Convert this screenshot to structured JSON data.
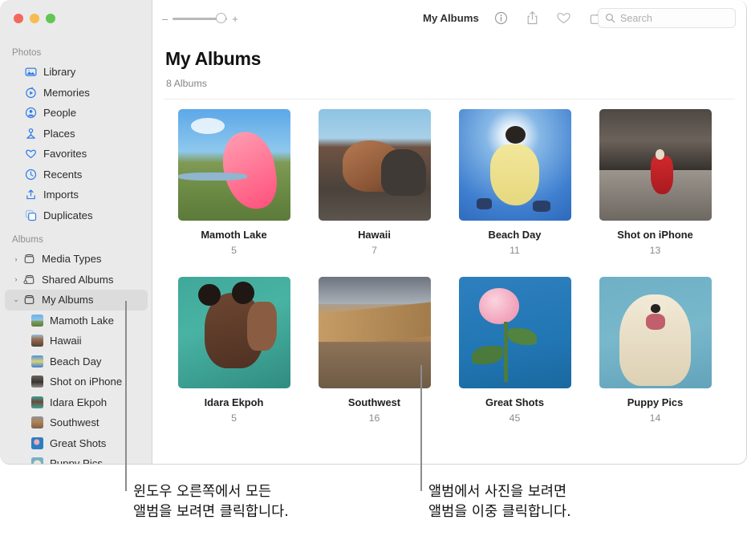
{
  "window": {
    "traffic_lights": [
      "close",
      "minimize",
      "zoom"
    ]
  },
  "toolbar": {
    "zoom_minus": "–",
    "zoom_plus": "+",
    "title": "My Albums",
    "icons": [
      {
        "name": "info-icon",
        "label": "Info"
      },
      {
        "name": "share-icon",
        "label": "Share"
      },
      {
        "name": "heart-icon",
        "label": "Favorite"
      },
      {
        "name": "rotate-icon",
        "label": "Rotate"
      }
    ],
    "search_placeholder": "Search",
    "search_value": ""
  },
  "sidebar": {
    "sections": [
      {
        "title": "Photos",
        "items": [
          {
            "label": "Library",
            "icon": "library-icon"
          },
          {
            "label": "Memories",
            "icon": "memories-icon"
          },
          {
            "label": "People",
            "icon": "people-icon"
          },
          {
            "label": "Places",
            "icon": "places-icon"
          },
          {
            "label": "Favorites",
            "icon": "favorites-icon"
          },
          {
            "label": "Recents",
            "icon": "recents-icon"
          },
          {
            "label": "Imports",
            "icon": "imports-icon"
          },
          {
            "label": "Duplicates",
            "icon": "duplicates-icon"
          }
        ]
      },
      {
        "title": "Albums",
        "groups": [
          {
            "label": "Media Types",
            "icon": "album-folder-icon",
            "twisty": "›",
            "expanded": false,
            "selected": false
          },
          {
            "label": "Shared Albums",
            "icon": "shared-album-icon",
            "twisty": "›",
            "expanded": false,
            "selected": false
          },
          {
            "label": "My Albums",
            "icon": "album-folder-icon",
            "twisty": "⌄",
            "expanded": true,
            "selected": true
          }
        ],
        "children": [
          {
            "label": "Mamoth Lake",
            "thumb": "#7fa9c9"
          },
          {
            "label": "Hawaii",
            "thumb": "#4a6073"
          },
          {
            "label": "Beach Day",
            "thumb": "#4e8ed4"
          },
          {
            "label": "Shot on iPhone",
            "thumb": "#4b4440"
          },
          {
            "label": "Idara Ekpoh",
            "thumb": "#3f9e93"
          },
          {
            "label": "Southwest",
            "thumb": "#8e6b4c"
          },
          {
            "label": "Great Shots",
            "thumb": "#2b7fc1"
          },
          {
            "label": "Puppy Pics",
            "thumb": "#7fb6c9"
          }
        ]
      }
    ]
  },
  "main": {
    "title": "My Albums",
    "subtitle": "8 Albums",
    "albums": [
      {
        "name": "Mamoth Lake",
        "count": "5",
        "thumb": "mamoth-lake"
      },
      {
        "name": "Hawaii",
        "count": "7",
        "thumb": "hawaii"
      },
      {
        "name": "Beach Day",
        "count": "11",
        "thumb": "beach-day"
      },
      {
        "name": "Shot on iPhone",
        "count": "13",
        "thumb": "shot-on-iphone"
      },
      {
        "name": "Idara Ekpoh",
        "count": "5",
        "thumb": "idara-ekpoh"
      },
      {
        "name": "Southwest",
        "count": "16",
        "thumb": "southwest"
      },
      {
        "name": "Great Shots",
        "count": "45",
        "thumb": "great-shots"
      },
      {
        "name": "Puppy Pics",
        "count": "14",
        "thumb": "puppy-pics"
      }
    ]
  },
  "callouts": [
    {
      "text": "윈도우 오른쪽에서 모든\n앨범을 보려면 클릭합니다."
    },
    {
      "text": "앨범에서 사진을 보려면\n앨범을 이중 클릭합니다."
    }
  ],
  "colors": {
    "accent": "#3478f6",
    "sidebar_bg": "#eaeaea",
    "selected_bg": "#dcdcdc",
    "callout_line": "#8c8c8c"
  }
}
